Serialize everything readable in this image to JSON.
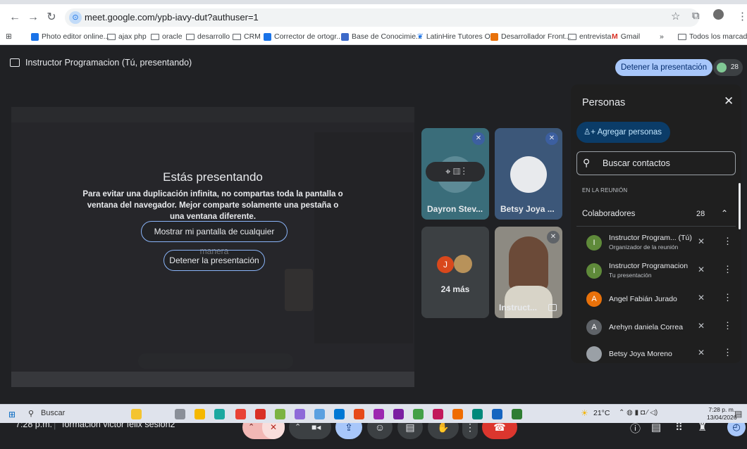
{
  "browser": {
    "url": "meet.google.com/ypb-iavy-dut?authuser=1",
    "bookmarks": [
      "Photo editor online...",
      "ajax php",
      "oracle",
      "desarrollo",
      "CRM",
      "Corrector de ortogr...",
      "Base de Conocimie...",
      "LatinHire Tutores O...",
      "Desarrollador Front...",
      "entrevista",
      "Gmail",
      "»",
      "Todos los marcadores"
    ]
  },
  "meet": {
    "presenter_banner": "Instructor Programacion (Tú, presentando)",
    "stop_presenting_top": "Detener la presentación",
    "participant_count": "28",
    "share": {
      "title": "Estás presentando",
      "description": "Para evitar una duplicación infinita, no compartas toda la pantalla o ventana del navegador. Mejor comparte solamente una pestaña o una ventana diferente.",
      "show_anyway": "Mostrar mi pantalla de cualquier manera",
      "stop": "Detener la presentación"
    },
    "tiles": {
      "dayron": "Dayron Stev...",
      "betsy": "Betsy Joya ...",
      "more": "24 más",
      "more_initial": "J",
      "instructor": "Instruct..."
    },
    "people_panel": {
      "title": "Personas",
      "add_people": "Agregar personas",
      "search_placeholder": "Buscar contactos",
      "in_meeting": "EN LA REUNIÓN",
      "collaborators": "Colaboradores",
      "collaborators_count": "28",
      "people": [
        {
          "initial": "I",
          "name": "Instructor Program... (Tú)",
          "sub": "Organizador de la reunión",
          "color": "#5f8a3a"
        },
        {
          "initial": "I",
          "name": "Instructor Programacion",
          "sub": "Tu presentación",
          "color": "#5f8a3a"
        },
        {
          "initial": "A",
          "name": "Angel Fabián Jurado",
          "sub": "",
          "color": "#e8710a"
        },
        {
          "initial": "A",
          "name": "Arehyn daniela Correa",
          "sub": "",
          "color": "#5f6368"
        },
        {
          "initial": "",
          "name": "Betsy Joya Moreno",
          "sub": "",
          "color": "#9aa0a6"
        }
      ]
    },
    "bar": {
      "time": "7:28 p.m.",
      "meeting_name": "formacion victor felix sesion2"
    }
  },
  "taskbar": {
    "search": "Buscar",
    "weather": "21°C",
    "time": "7:28 p. m.",
    "date": "13/04/2026"
  }
}
